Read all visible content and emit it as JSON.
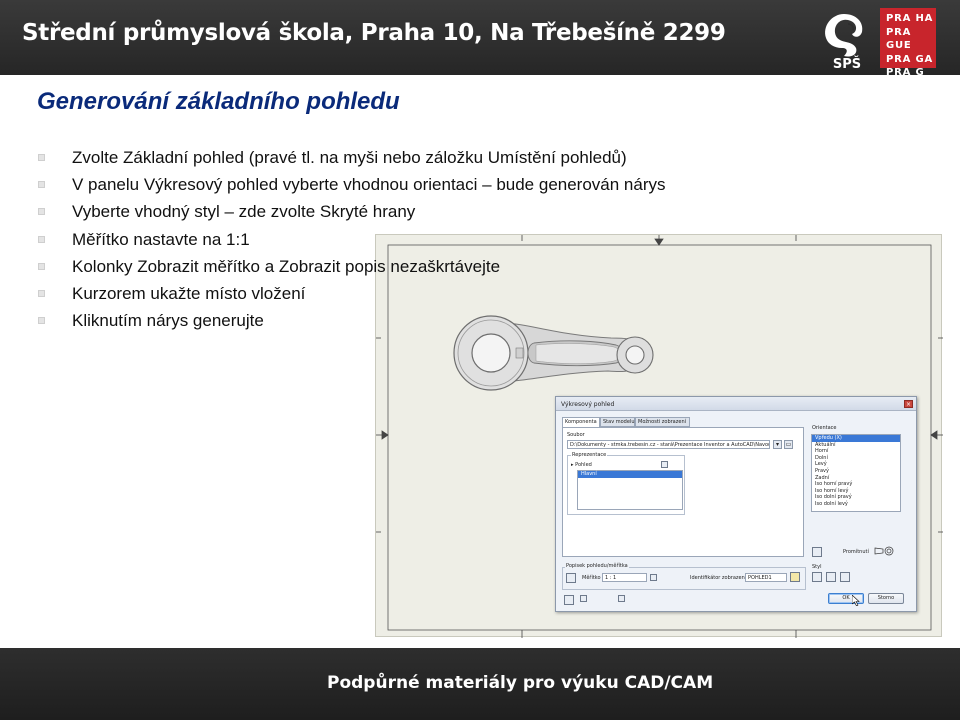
{
  "header": {
    "title": "Střední průmyslová škola, Praha 10, Na Třebešíně 2299",
    "logo_sps_text": "SPŠ",
    "logo_praha_lines": [
      "PRA HA",
      "PRA GUE",
      "PRA GA",
      "PRA G"
    ]
  },
  "slide": {
    "title": "Generování základního pohledu",
    "bullets": [
      "Zvolte Základní pohled (pravé tl. na myši nebo záložku Umístění pohledů)",
      "V panelu Výkresový pohled vyberte vhodnou orientaci – bude generován nárys",
      "Vyberte vhodný styl – zde zvolte Skryté hrany",
      "Měřítko nastavte na 1:1",
      "Kolonky Zobrazit měřítko a Zobrazit popis nezaškrtávejte",
      "Kurzorem ukažte místo vložení",
      "Kliknutím nárys generujte"
    ]
  },
  "dialog": {
    "title": "Výkresový pohled",
    "tabs": [
      "Komponenta",
      "Stav modelu",
      "Možnosti zobrazení"
    ],
    "file_label": "Soubor",
    "file_path": "D:\\Dokumenty - stmka.trebesin.cz - stará\\Prezentace Inventor a AutoCAD\\Navod",
    "representation_label": "Reprezentace",
    "representation_items": [
      "Pohled",
      "Hlavní"
    ],
    "orientation_label": "Orientace",
    "orientation_items": [
      "Vpředu (X)",
      "Aktuální",
      "Horní",
      "Dolní",
      "Levý",
      "Pravý",
      "Zadní",
      "Iso horní pravý",
      "Iso horní levý",
      "Iso dolní pravý",
      "Iso dolní levý"
    ],
    "projection_label": "Promítnutí",
    "caption_group": "Popisek pohledu/měřítka",
    "scale_label": "Měřítko",
    "scale_value": "1 : 1",
    "identifier_label": "Identifikátor zobrazení",
    "identifier_value": "POHLED1",
    "style_label": "Styl",
    "ok_label": "OK",
    "cancel_label": "Storno"
  },
  "footer": {
    "text": "Podpůrné materiály pro výuku CAD/CAM"
  },
  "colors": {
    "header_bg": "#2d2d2d",
    "title_blue": "#0a2a7a",
    "praha_red": "#c8252c",
    "sheet_bg": "#eeeee6",
    "selection_blue": "#3a78d6"
  }
}
